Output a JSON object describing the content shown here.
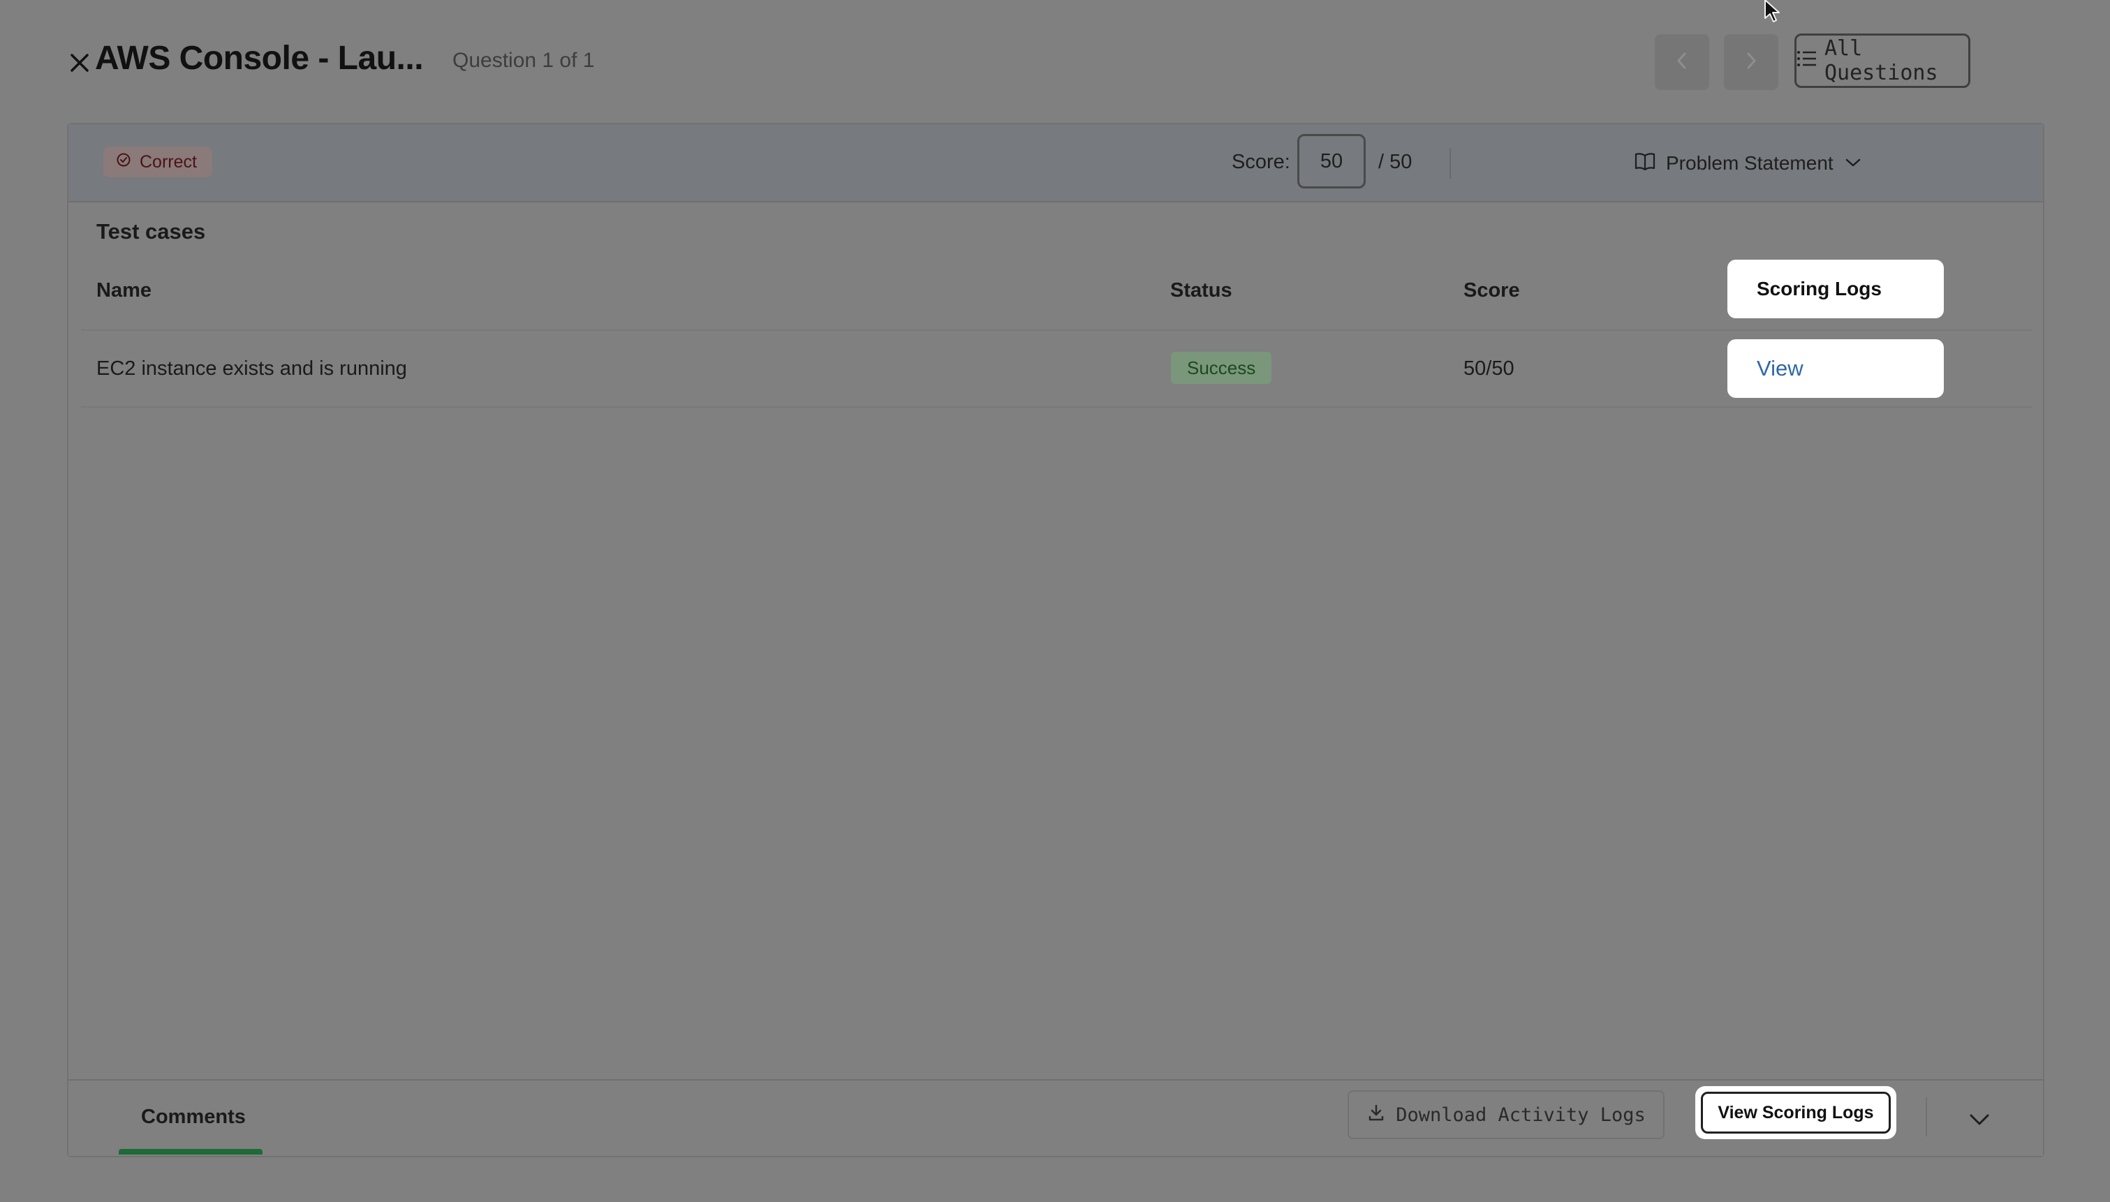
{
  "header": {
    "title": "AWS Console - Lau...",
    "question_count": "Question 1 of 1",
    "all_questions_label": "All Questions"
  },
  "score_bar": {
    "result_badge": "Correct",
    "score_label": "Score:",
    "score_value": "50",
    "score_total": "/ 50",
    "problem_statement_label": "Problem Statement"
  },
  "test_cases": {
    "title": "Test cases",
    "columns": [
      "Name",
      "Status",
      "Score",
      "Scoring Logs"
    ],
    "rows": [
      {
        "name": "EC2 instance exists and is running",
        "status": "Success",
        "score": "50/50",
        "action": "View"
      }
    ]
  },
  "footer": {
    "comments_tab": "Comments",
    "download_label": "Download Activity Logs",
    "view_scoring_logs_label": "View Scoring Logs"
  },
  "colors": {
    "overlay_bg": "#808080",
    "success_badge": "#7a967b",
    "view_link": "#2d68a8",
    "active_tab_underline": "#1d6b36"
  }
}
